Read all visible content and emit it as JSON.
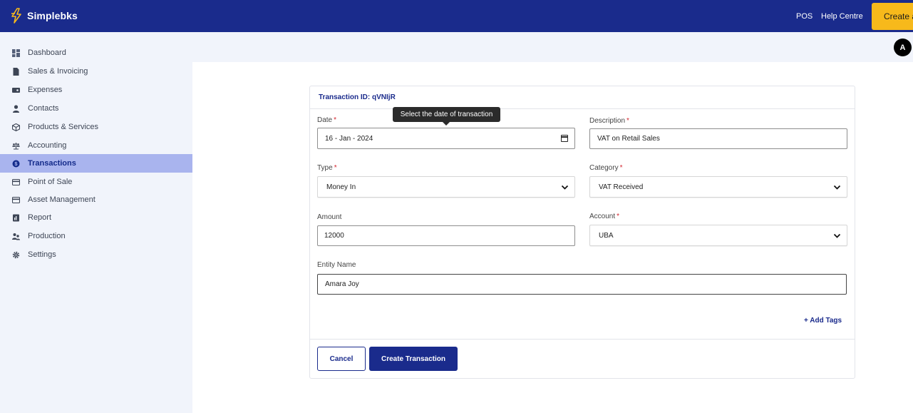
{
  "app": {
    "name": "Simplebks"
  },
  "header": {
    "links": [
      "POS",
      "Help Centre"
    ],
    "create_label": "Create a"
  },
  "user": {
    "avatar_initial": "A"
  },
  "sidebar": {
    "items": [
      {
        "label": "Dashboard",
        "icon": "dashboard-icon"
      },
      {
        "label": "Sales & Invoicing",
        "icon": "document-icon"
      },
      {
        "label": "Expenses",
        "icon": "wallet-icon"
      },
      {
        "label": "Contacts",
        "icon": "person-icon"
      },
      {
        "label": "Products & Services",
        "icon": "box-icon"
      },
      {
        "label": "Accounting",
        "icon": "scale-icon"
      },
      {
        "label": "Transactions",
        "icon": "transactions-icon",
        "active": true
      },
      {
        "label": "Point of Sale",
        "icon": "card-icon"
      },
      {
        "label": "Asset Management",
        "icon": "card-icon"
      },
      {
        "label": "Report",
        "icon": "report-icon"
      },
      {
        "label": "Production",
        "icon": "people-icon"
      },
      {
        "label": "Settings",
        "icon": "gear-icon"
      }
    ]
  },
  "form": {
    "transaction_id": "Transaction ID: qVNIjR",
    "tooltip": "Select the date of transaction",
    "date": {
      "label": "Date",
      "value": "16 - Jan - 2024"
    },
    "description": {
      "label": "Description",
      "value": "VAT on Retail Sales"
    },
    "type": {
      "label": "Type",
      "value": "Money In"
    },
    "category": {
      "label": "Category",
      "value": "VAT Received"
    },
    "amount": {
      "label": "Amount",
      "value": "12000"
    },
    "account": {
      "label": "Account",
      "value": "UBA"
    },
    "entity": {
      "label": "Entity Name",
      "value": "Amara Joy"
    },
    "required_mark": "*",
    "add_tags": "+ Add Tags",
    "cancel": "Cancel",
    "create": "Create Transaction"
  },
  "colors": {
    "brand": "#1a2b8c",
    "accent": "#f7b91b",
    "active_nav": "#a9b4ee"
  }
}
